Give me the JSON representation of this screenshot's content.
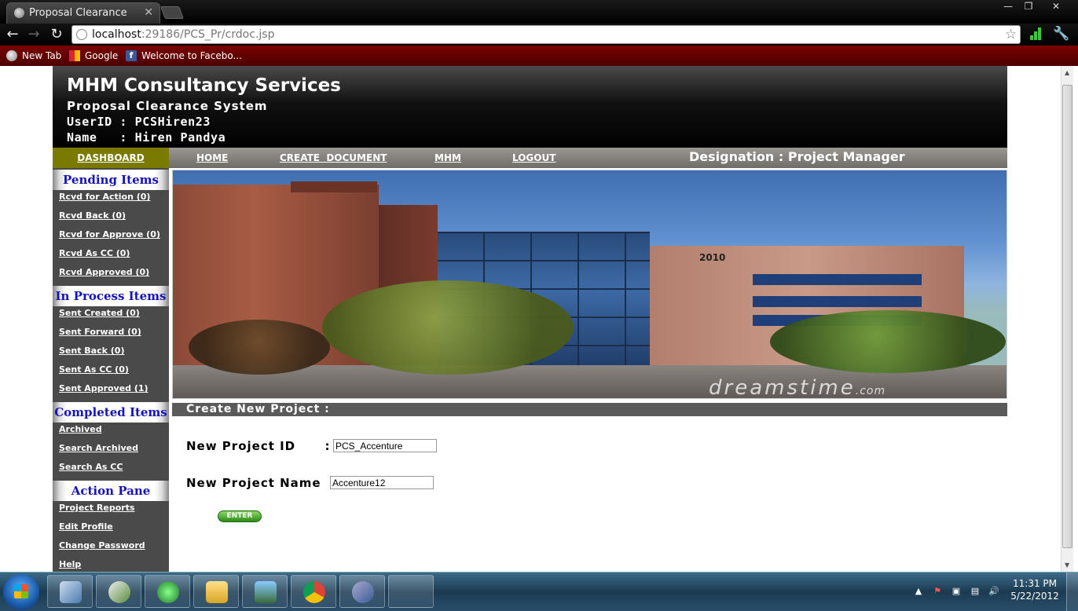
{
  "browser": {
    "tab_title": "Proposal Clearance System",
    "tab_close": "✕",
    "url_host": "localhost",
    "url_path": ":29186/PCS_Pr/crdoc.jsp",
    "bookmarks": [
      "New Tab",
      "Google",
      "Welcome to Facebo..."
    ],
    "facebook_glyph": "f",
    "window_controls": {
      "minimize": "—",
      "maximize": "❐",
      "close": "✕"
    },
    "nav_glyphs": {
      "back": "←",
      "forward": "→",
      "reload": "↻",
      "star": "☆",
      "wrench": "🔧"
    }
  },
  "header": {
    "company": "MHM Consultancy Services",
    "system": "Proposal Clearance System",
    "userid_line": "UserID : PCSHiren23",
    "name_line": "Name   : Hiren Pandya"
  },
  "menu": {
    "dashboard": "DASHBOARD",
    "home": "HOME",
    "create": "CREATE  DOCUMENT",
    "mhm": "MHM",
    "logout": "LOGOUT",
    "designation": "Designation : Project Manager"
  },
  "sidebar": {
    "pending_title": "Pending Items",
    "pending": [
      "Rcvd for Action (0)",
      "Rcvd Back (0)",
      "Rcvd for Approve (0)",
      "Rcvd As CC (0)",
      "Rcvd Approved (0)"
    ],
    "inprocess_title": "In Process Items",
    "inprocess": [
      "Sent Created (0)",
      "Sent Forward (0)",
      "Sent Back (0)",
      "Sent As CC (0)",
      "Sent Approved (1)"
    ],
    "completed_title": "Completed Items",
    "completed": [
      "Archived",
      "Search Archived",
      "Search As CC"
    ],
    "action_title": "Action Pane",
    "action": [
      "Project Reports",
      "Edit Profile",
      "Change Password",
      "Help"
    ]
  },
  "banner": {
    "building_number": "2010",
    "watermark": "dreamstime",
    "watermark_suffix": ".com"
  },
  "form": {
    "title": "Create New Project :",
    "project_id_label": "New Project ID      :",
    "project_id_value": "PCS_Accenture",
    "project_name_label": "New Project Name  :",
    "project_name_value": "Accenture12",
    "enter_label": "ENTER"
  },
  "taskbar": {
    "time": "11:31 PM",
    "date": "5/22/2012",
    "tray_glyphs": [
      "▲",
      "⚑",
      "▣",
      "▤",
      "🔊"
    ]
  },
  "colors": {
    "menu_dashboard": "#7a7a00",
    "sidebar_bg": "#4a4a4a",
    "section_title": "#1414b8",
    "bookmarks_bar": "#6b0000"
  }
}
